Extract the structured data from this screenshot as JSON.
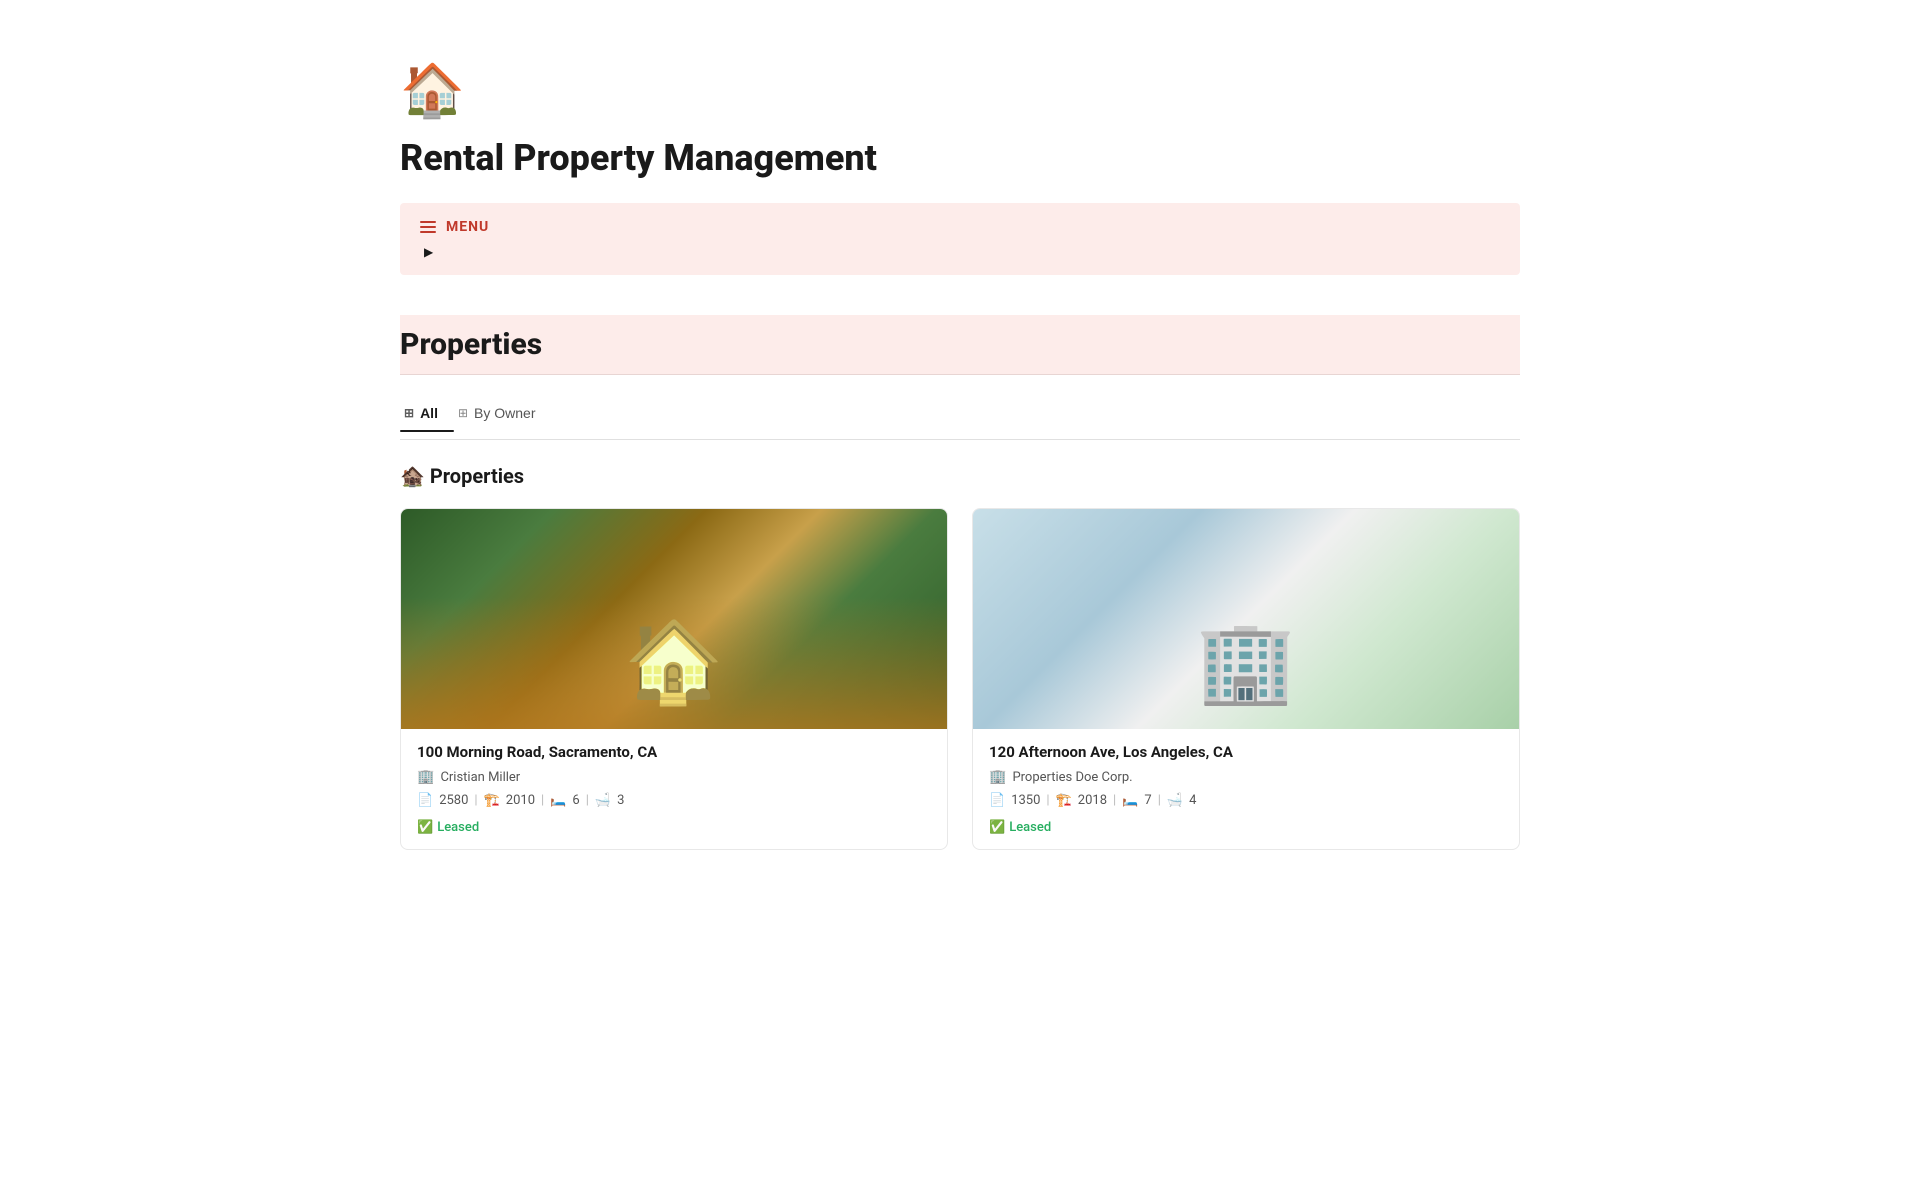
{
  "app": {
    "logo": "🏠",
    "logo_color": "#c0392b",
    "title": "Rental Property Management"
  },
  "menu": {
    "label": "MENU",
    "arrow": "▶"
  },
  "sections": {
    "properties": {
      "title": "Properties",
      "sub_title": "🏚️ Properties"
    }
  },
  "tabs": [
    {
      "id": "all",
      "label": "All",
      "icon": "⊞",
      "active": true
    },
    {
      "id": "by-owner",
      "label": "By Owner",
      "icon": "⊞",
      "active": false
    }
  ],
  "properties": [
    {
      "id": 1,
      "address": "100 Morning Road, Sacramento, CA",
      "owner": "Cristian Miller",
      "owner_icon": "🏢",
      "sqft": "2580",
      "year": "2010",
      "beds": "6",
      "baths": "3",
      "status": "Leased",
      "status_icon": "✅",
      "image_type": "house"
    },
    {
      "id": 2,
      "address": "120 Afternoon Ave, Los Angeles, CA",
      "owner": "Properties Doe Corp.",
      "owner_icon": "🏢",
      "sqft": "1350",
      "year": "2018",
      "beds": "7",
      "baths": "4",
      "status": "Leased",
      "status_icon": "✅",
      "image_type": "apartment"
    }
  ],
  "icons": {
    "sqft": "📄",
    "year": "🏗️",
    "beds": "🛏️",
    "baths": "🛁"
  }
}
